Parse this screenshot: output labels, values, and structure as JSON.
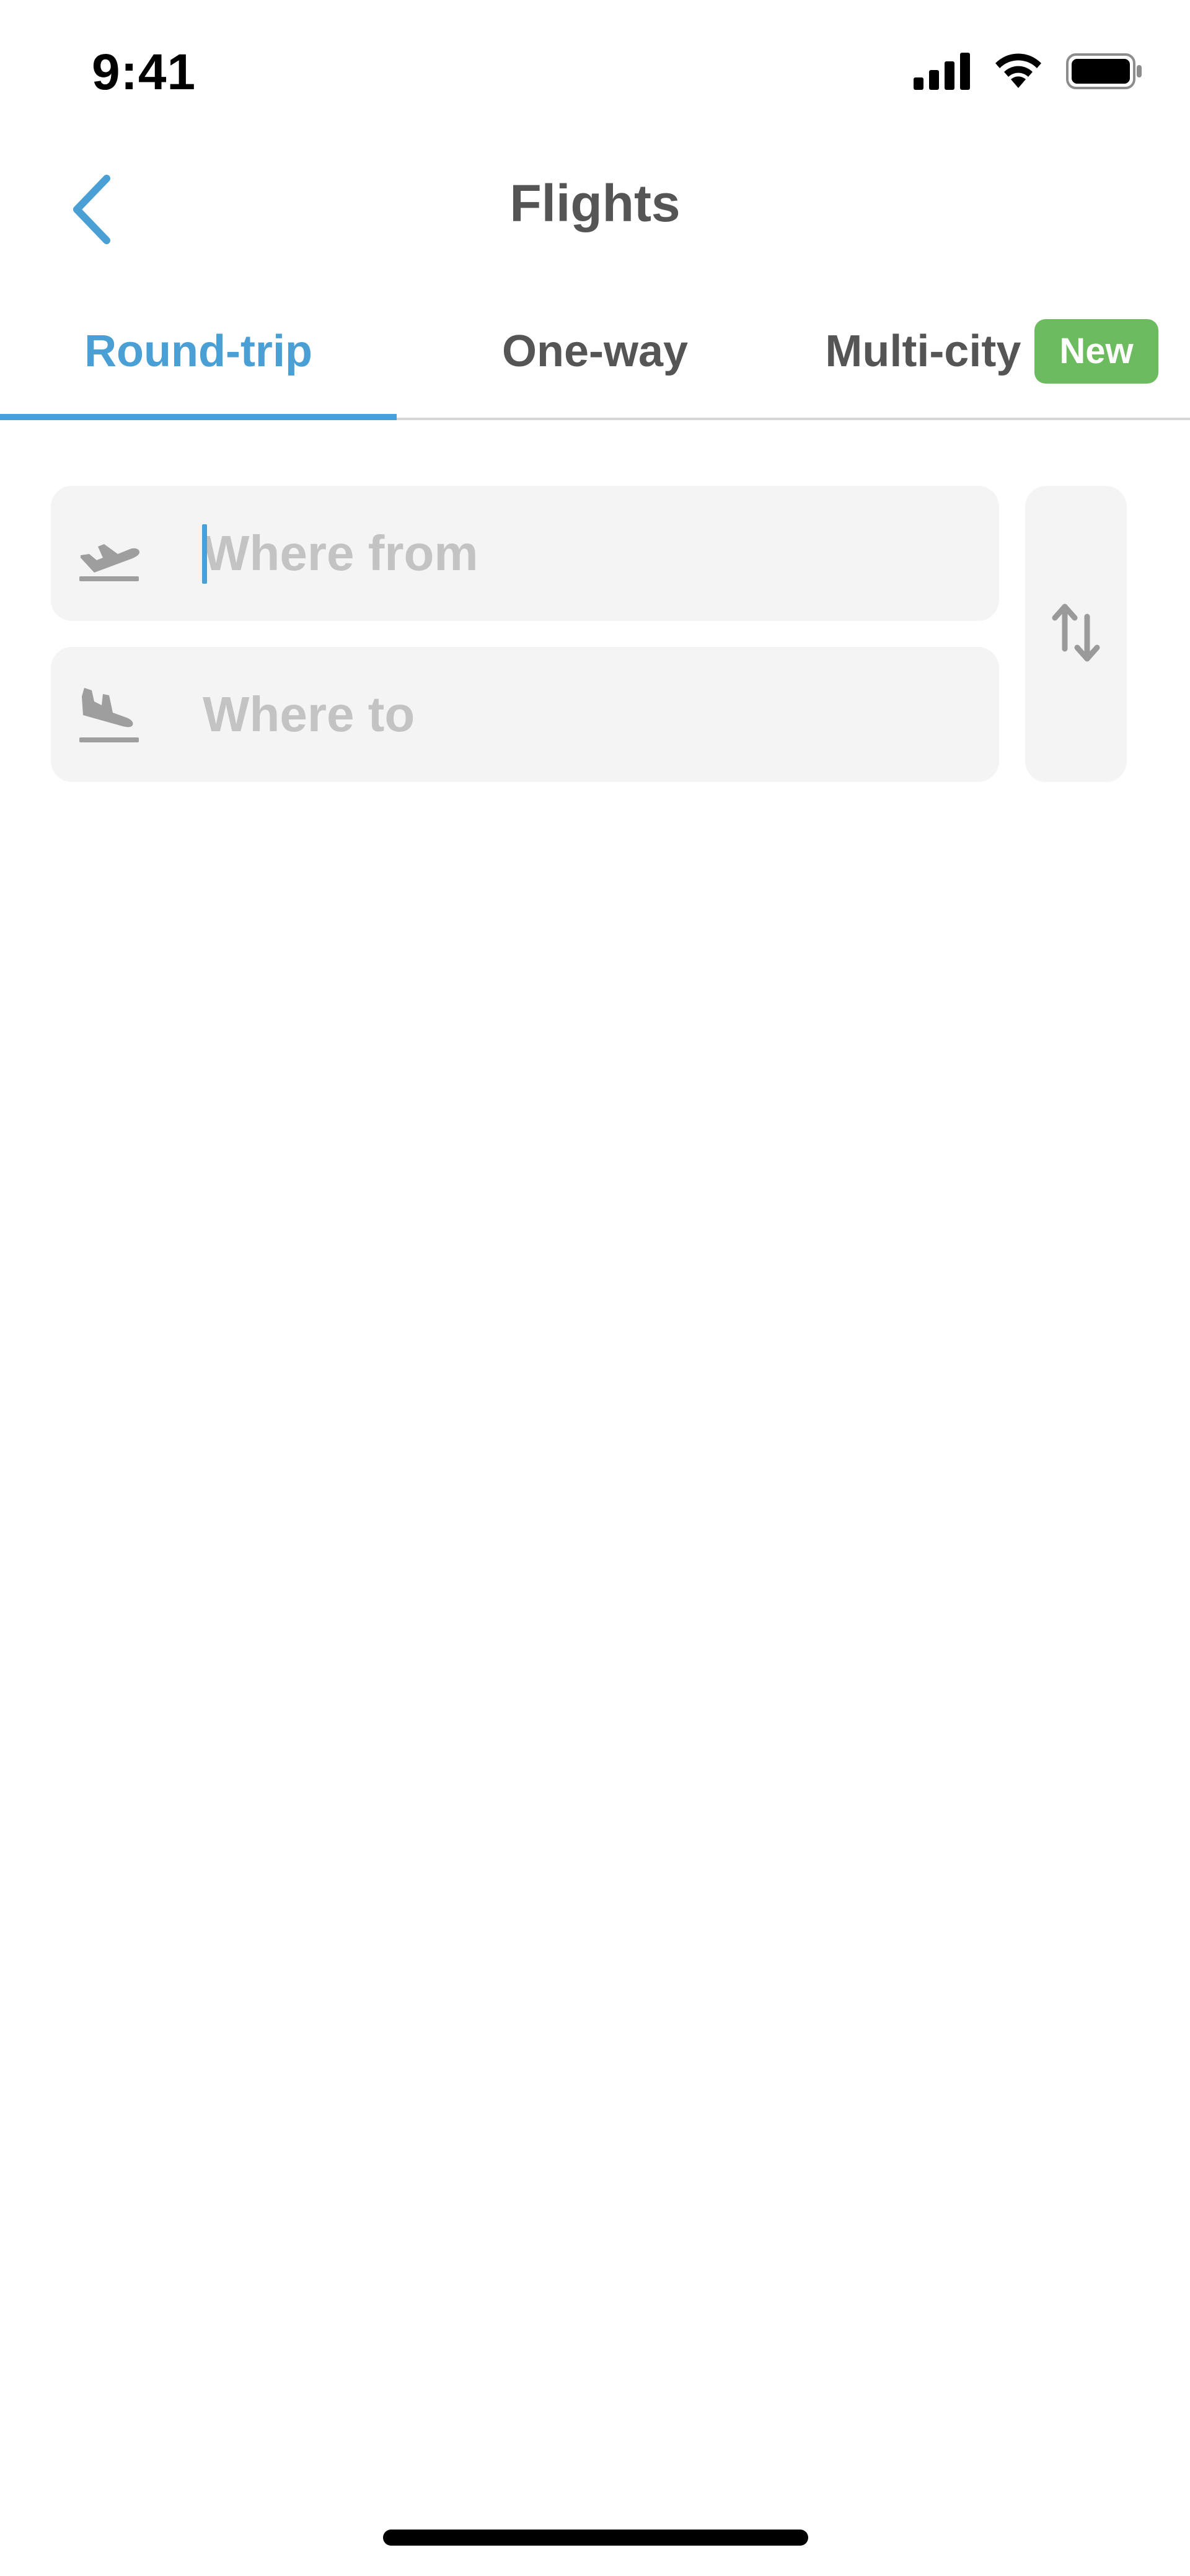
{
  "status_bar": {
    "time": "9:41",
    "icons": [
      "cellular-signal-icon",
      "wifi-icon",
      "battery-icon"
    ]
  },
  "nav": {
    "title": "Flights",
    "back_icon": "chevron-left-icon"
  },
  "tabs": [
    {
      "label": "Round-trip",
      "active": true
    },
    {
      "label": "One-way",
      "active": false
    },
    {
      "label": "Multi-city",
      "active": false,
      "badge": "New"
    }
  ],
  "search": {
    "from": {
      "placeholder": "Where from",
      "value": "",
      "icon": "plane-takeoff-icon"
    },
    "to": {
      "placeholder": "Where to",
      "value": "",
      "icon": "plane-landing-icon"
    },
    "swap_icon": "swap-arrows-icon"
  },
  "colors": {
    "accent": "#4a9fd5",
    "badge": "#6cbb5f",
    "field_bg": "#f4f4f4",
    "text_dark": "#555555",
    "placeholder": "#c3c3c3"
  }
}
